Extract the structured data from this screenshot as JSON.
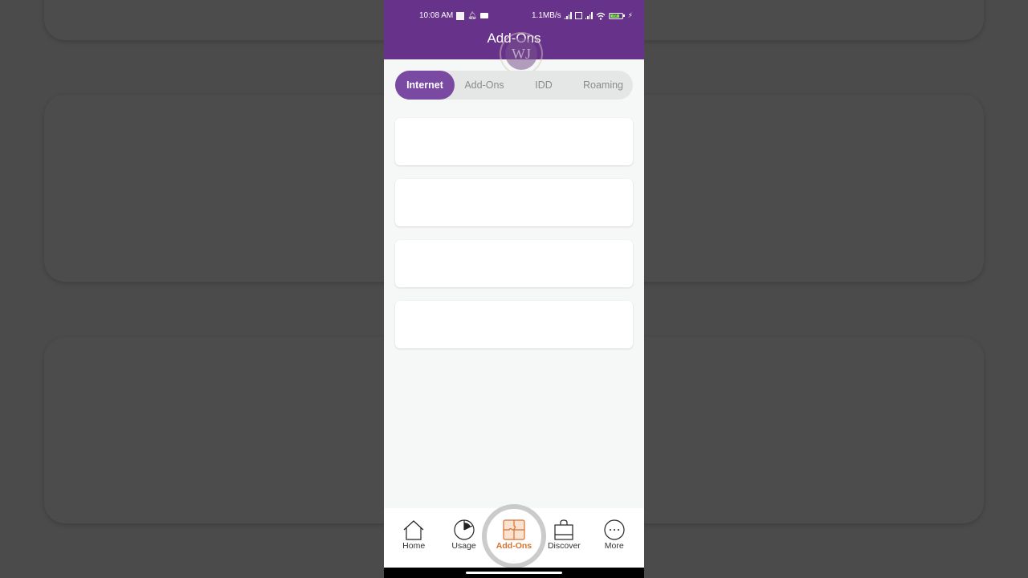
{
  "status_bar": {
    "time": "10:08 AM",
    "network_speed": "1.1MB/s",
    "battery_level": "79"
  },
  "header": {
    "title": "Add-Ons",
    "watermark": "WJ"
  },
  "tabs": [
    {
      "label": "Internet",
      "active": true
    },
    {
      "label": "Add-Ons",
      "active": false
    },
    {
      "label": "IDD",
      "active": false
    },
    {
      "label": "Roaming",
      "active": false
    }
  ],
  "cards_count": 4,
  "bottom_nav": [
    {
      "label": "Home",
      "icon": "home-icon",
      "active": false
    },
    {
      "label": "Usage",
      "icon": "pie-chart-icon",
      "active": false
    },
    {
      "label": "Add-Ons",
      "icon": "puzzle-icon",
      "active": true
    },
    {
      "label": "Discover",
      "icon": "shopping-bag-icon",
      "active": false
    },
    {
      "label": "More",
      "icon": "more-icon",
      "active": false
    }
  ],
  "colors": {
    "primary": "#67338a",
    "tab_active": "#7a4aa3",
    "nav_active": "#d8712f"
  }
}
